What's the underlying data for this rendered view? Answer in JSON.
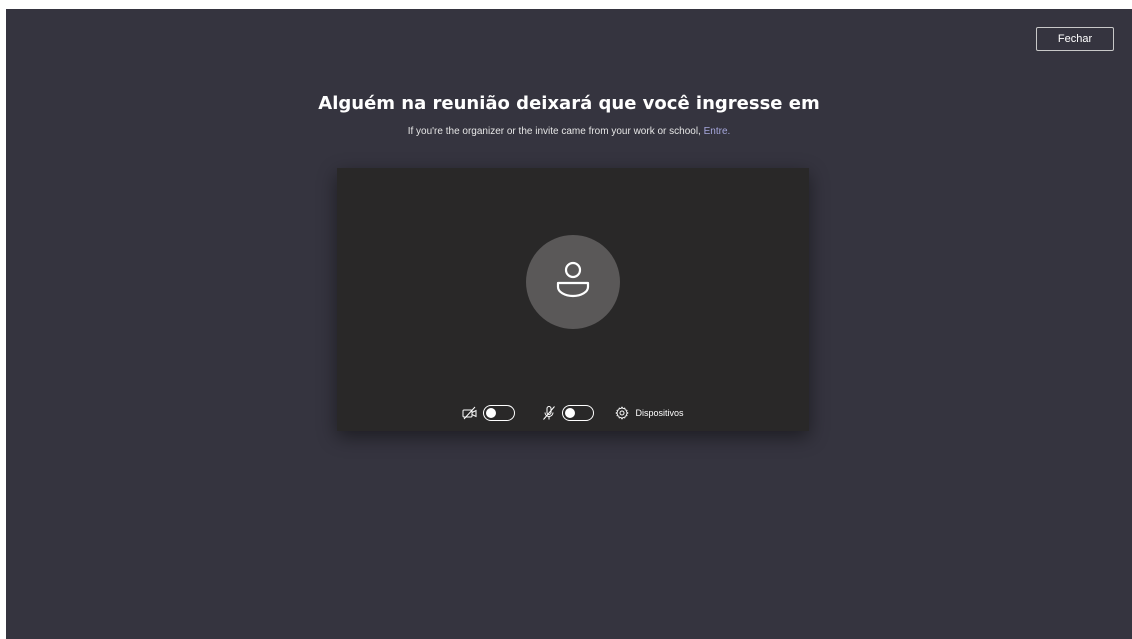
{
  "header": {
    "close_label": "Fechar"
  },
  "main": {
    "title": "Alguém na reunião deixará que você ingresse em",
    "subtitle_text": "If you're the organizer or the invite came from your work or school,",
    "subtitle_link": "Entre."
  },
  "preview": {
    "avatar_icon": "person-icon",
    "controls": {
      "camera_icon": "camera-off-icon",
      "camera_toggle_on": false,
      "mic_icon": "mic-off-icon",
      "mic_toggle_on": false,
      "devices_icon": "gear-icon",
      "devices_label": "Dispositivos"
    }
  },
  "colors": {
    "background": "#35343f",
    "preview_bg": "#292828",
    "avatar_bg": "#5a5858",
    "link": "#a6a7dc"
  }
}
